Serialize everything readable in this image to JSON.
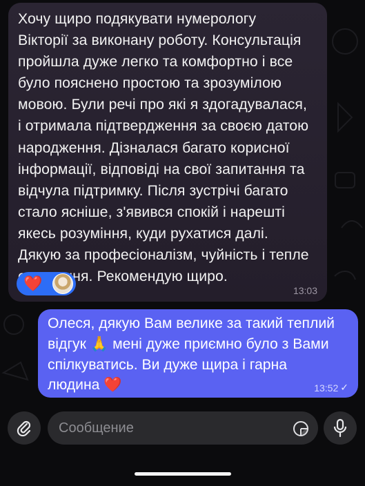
{
  "incoming_message": {
    "text": "Хочу щиро подякувати нумерологу\nВікторії за виконану роботу. Консультація\nпройшла дуже легко та комфортно і все\nбуло пояснено простою та зрозумілою\nмовою. Були речі про  які я здогадувалася,\nі отримала підтвердження за своєю датою\nнародження. Дізналася багато корисної\nінформації, відповіді на свої запитання та\nвідчула підтримку. Після зустрічі багато\nстало ясніше, з'явився спокій і нарешті\nякесь розуміння, куди рухатися далі.\nДякую за професіоналізм, чуйність і тепле\nставлення. Рекомендую щиро.",
    "time": "13:03",
    "reaction": {
      "emoji": "❤️"
    }
  },
  "outgoing_message": {
    "text": "Олеся, дякую Вам велике за такий теплий\nвідгук 🙏 мені дуже приємно було з Вами\nспілкуватись. Ви дуже щира і гарна\nлюдина ❤️",
    "time": "13:52",
    "status": "✓"
  },
  "composer": {
    "placeholder": "Сообщение"
  },
  "icons": {
    "attach": "paperclip-icon",
    "sticker": "sticker-icon",
    "mic": "microphone-icon"
  },
  "colors": {
    "incoming_bubble": "#2b2533",
    "outgoing_bubble": "#5a62f2",
    "reaction_pill": "#2d6df6",
    "background": "#0b0b0d"
  }
}
